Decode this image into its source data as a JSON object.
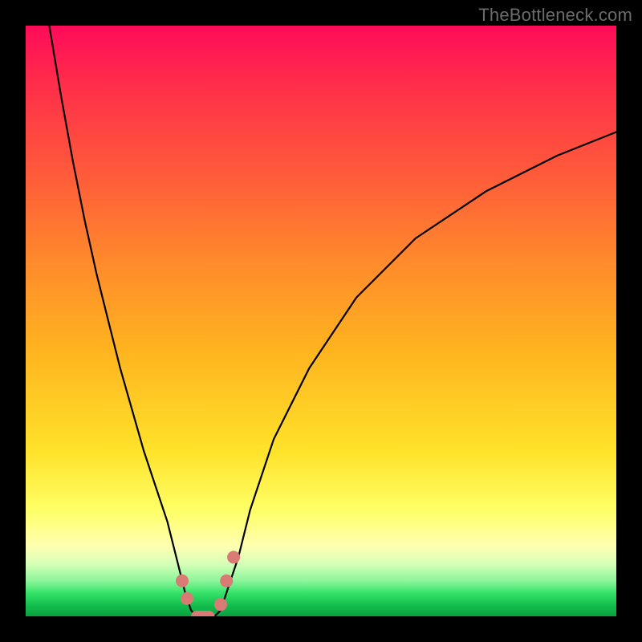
{
  "watermark": "TheBottleneck.com",
  "colors": {
    "frame": "#000000",
    "curve": "#000000",
    "marker": "#da7a74",
    "gradient_top": "#ff0b59",
    "gradient_bottom": "#0a9f3e"
  },
  "chart_data": {
    "type": "line",
    "title": "",
    "xlabel": "",
    "ylabel": "",
    "xlim": [
      0,
      100
    ],
    "ylim": [
      0,
      100
    ],
    "notes": "Bottleneck-style curve: sharp V-shaped minimum. Y appears to be bottleneck % (0 at bottom/green, 100 at top/red). X is an unlabeled component scale. Minimum (≈0%) occurs around x≈27–33. Left branch rises steeply to 100% near x≈4; right branch rises slowly toward ≈82% at x=100.",
    "series": [
      {
        "name": "bottleneck-curve",
        "x": [
          4,
          6,
          8,
          10,
          12,
          14,
          16,
          18,
          20,
          22,
          24,
          26,
          27,
          28,
          29,
          30,
          31,
          32,
          33,
          34,
          36,
          38,
          42,
          48,
          56,
          66,
          78,
          90,
          100
        ],
        "y": [
          100,
          88,
          77,
          67,
          58,
          50,
          42,
          35,
          28,
          22,
          16,
          8,
          4,
          1,
          0,
          0,
          0,
          0,
          1,
          4,
          10,
          18,
          30,
          42,
          54,
          64,
          72,
          78,
          82
        ]
      }
    ],
    "markers": [
      {
        "x": 26.5,
        "y": 6
      },
      {
        "x": 27.3,
        "y": 3
      },
      {
        "x": 33.0,
        "y": 2
      },
      {
        "x": 34.0,
        "y": 6
      },
      {
        "x": 35.2,
        "y": 10
      }
    ],
    "optimum_band": {
      "x_start": 28,
      "x_end": 32,
      "y": 0
    }
  }
}
